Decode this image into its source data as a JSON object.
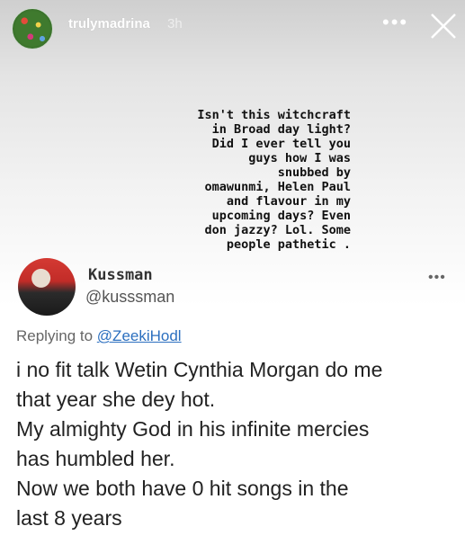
{
  "story": {
    "username": "trulymadrina",
    "time": "3h",
    "caption_lines": [
      "Isn't this witchcraft",
      "in Broad day light?",
      "Did I ever tell you",
      "guys how I was",
      "snubbed by",
      "omawunmi, Helen Paul",
      "and flavour in my",
      "upcoming days? Even",
      "don jazzy? Lol. Some",
      "people pathetic ."
    ]
  },
  "tweet": {
    "display_name": "Kussman",
    "handle": "@kusssman",
    "replying_label": "Replying to",
    "replying_handle": "@ZeekiHodl",
    "body_lines": [
      "i no fit talk Wetin Cynthia Morgan do me",
      "that year she dey hot.",
      "My almighty God in his infinite mercies",
      "has humbled her.",
      "Now we both have 0 hit songs in the",
      "last 8 years"
    ]
  }
}
